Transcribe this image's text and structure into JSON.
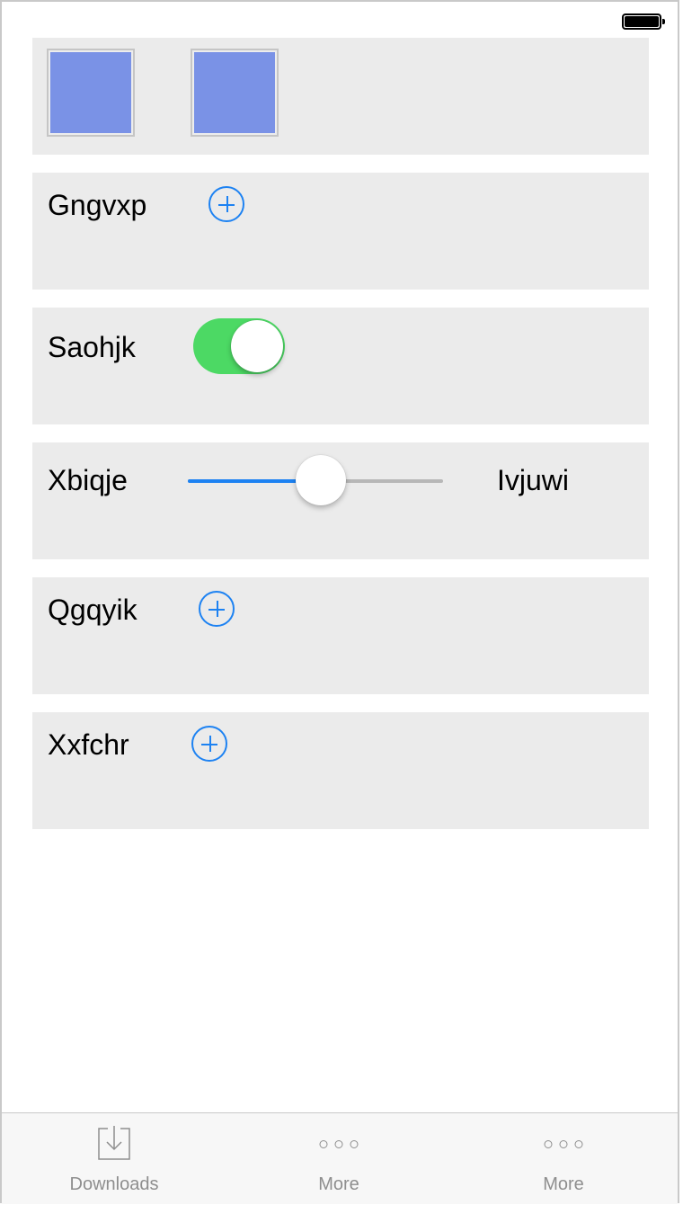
{
  "rows": [
    {
      "label": "Gngvxp"
    },
    {
      "label": "Saohjk",
      "toggle_on": true
    },
    {
      "label": "Xbiqje",
      "slider_value": 0.5,
      "slider_max_label": "Ivjuwi"
    },
    {
      "label": "Qgqyik"
    },
    {
      "label": "Xxfchr"
    }
  ],
  "colors": {
    "accent": "#1d82f2",
    "toggle_on": "#4cd964",
    "tile": "#7a92e6",
    "card_bg": "#ebebeb"
  },
  "tabbar": {
    "tabs": [
      {
        "label": "Downloads",
        "icon": "download-icon"
      },
      {
        "label": "More",
        "icon": "more-icon"
      },
      {
        "label": "More",
        "icon": "more-icon"
      }
    ]
  }
}
